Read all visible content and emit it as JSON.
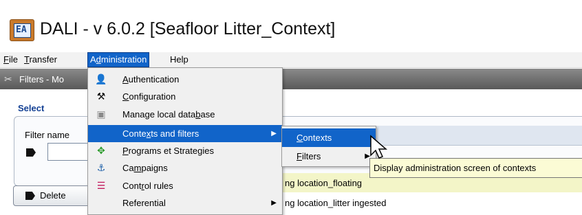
{
  "window": {
    "title": "DALI - v 6.0.2 [Seafloor Litter_Context]",
    "app_icon_glyph": "EA"
  },
  "menubar": [
    {
      "label": "File",
      "underline": "F",
      "rest": "ile"
    },
    {
      "label": "Transfer",
      "underline": "T",
      "rest": "ransfer"
    },
    {
      "label": "Administration",
      "pre": "A",
      "underline": "d",
      "rest": "ministration"
    },
    {
      "label": "Help",
      "underline": "",
      "rest": "Help"
    }
  ],
  "panel": {
    "title": "Filters - Mo",
    "icon": "tools-icon"
  },
  "select_section": {
    "label": "Select",
    "filter_name_label": "Filter name",
    "delete_button": "Delete"
  },
  "rows": [
    {
      "text": "ng location_floating"
    },
    {
      "text": "ng location_litter ingested"
    }
  ],
  "admin_menu": {
    "items": [
      {
        "pre": "",
        "u": "A",
        "post": "uthentication",
        "icon": "user-icon"
      },
      {
        "pre": "",
        "u": "C",
        "post": "onfiguration",
        "icon": "tools-icon"
      },
      {
        "pre": "Manage local data",
        "u": "b",
        "post": "ase",
        "icon": "database-icon"
      },
      {
        "pre": "Conte",
        "u": "x",
        "post": "ts and filters",
        "icon": "",
        "arrow": "▶"
      },
      {
        "pre": "",
        "u": "P",
        "post": "rograms et Strategies",
        "icon": "programs-icon"
      },
      {
        "pre": "Ca",
        "u": "m",
        "post": "paigns",
        "icon": "campaign-icon"
      },
      {
        "pre": "Cont",
        "u": "r",
        "post": "ol rules",
        "icon": "rules-icon"
      },
      {
        "pre": "Referential",
        "u": "",
        "post": "",
        "icon": "",
        "arrow": "▶"
      }
    ]
  },
  "sub_menu": {
    "items": [
      {
        "pre": "",
        "u": "C",
        "post": "ontexts"
      },
      {
        "pre": "",
        "u": "F",
        "post": "ilters",
        "arrow": "▶"
      }
    ]
  },
  "tooltip": "Display administration screen of contexts",
  "colors": {
    "menu_highlight": "#1164c9",
    "tooltip_bg": "#fbfbd5",
    "panel_header": "#6d6d6d"
  }
}
